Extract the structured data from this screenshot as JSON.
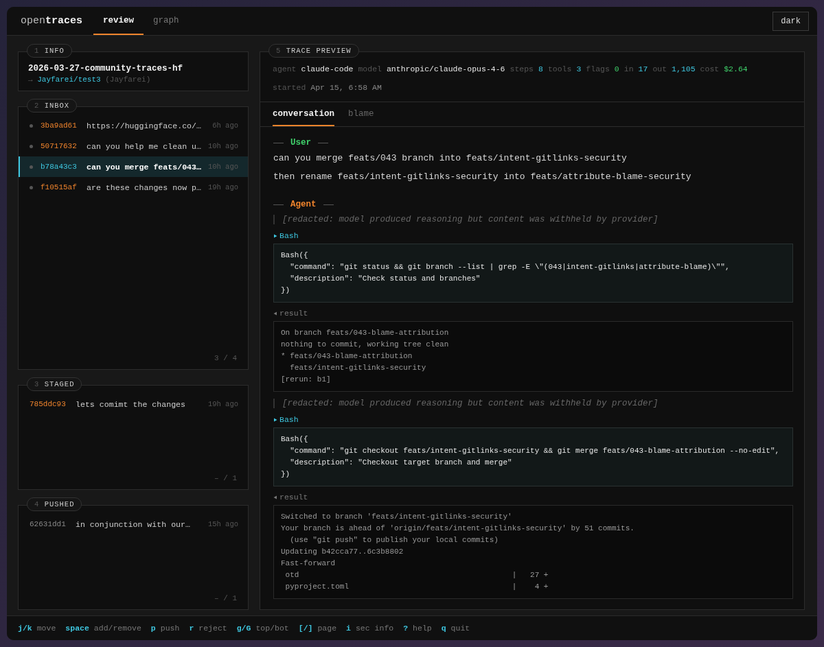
{
  "app": {
    "brand_light": "open",
    "brand_bold": "traces"
  },
  "tabs": [
    {
      "label": "review",
      "selected": true
    },
    {
      "label": "graph",
      "selected": false
    }
  ],
  "theme_button": "dark",
  "info": {
    "number": "1",
    "title": "INFO",
    "name": "2026-03-27-community-traces-hf",
    "arrow": "→",
    "repo": "Jayfarei/test3",
    "owner": "(Jayfarei)"
  },
  "sections": [
    {
      "kind": "inbox",
      "number": "2",
      "title": "INBOX",
      "counter": "3 / 4",
      "items": [
        {
          "hash": "3ba9ad61",
          "text": "https://huggingface.co/…",
          "time": "6h ago",
          "selected": false
        },
        {
          "hash": "50717632",
          "text": "can you help me clean u…",
          "time": "10h ago",
          "selected": false
        },
        {
          "hash": "b78a43c3",
          "text": "can you merge feats/043…",
          "time": "10h ago",
          "selected": true
        },
        {
          "hash": "f10515af",
          "text": "are these changes now p…",
          "time": "19h ago",
          "selected": false
        }
      ]
    },
    {
      "kind": "staged",
      "number": "3",
      "title": "STAGED",
      "counter": "– / 1",
      "items": [
        {
          "hash": "785ddc93",
          "text": "lets comimt the changes",
          "time": "19h ago",
          "selected": false
        }
      ]
    },
    {
      "kind": "pushed",
      "number": "4",
      "title": "PUSHED",
      "counter": "– / 1",
      "items": [
        {
          "hash": "62631dd1",
          "text": "in conjunction with our…",
          "time": "15h ago",
          "selected": false
        }
      ]
    }
  ],
  "preview": {
    "number": "5",
    "title": "TRACE PREVIEW",
    "stats": [
      {
        "label": "agent",
        "value": "claude-code",
        "kind": "plain"
      },
      {
        "label": "model",
        "value": "anthropic/claude-opus-4-6",
        "kind": "plain"
      },
      {
        "label": "steps",
        "value": "8",
        "kind": "count"
      },
      {
        "label": "tools",
        "value": "3",
        "kind": "count"
      },
      {
        "label": "flags",
        "value": "0",
        "kind": "good"
      },
      {
        "label": "in",
        "value": "17",
        "kind": "count"
      },
      {
        "label": "out",
        "value": "1,105",
        "kind": "count"
      },
      {
        "label": "cost",
        "value": "$2.64",
        "kind": "good"
      }
    ],
    "started_label": "started",
    "started": "Apr 15, 6:58 AM",
    "tabs": [
      {
        "label": "conversation",
        "selected": true
      },
      {
        "label": "blame",
        "selected": false
      }
    ],
    "blocks": [
      {
        "kind": "speaker",
        "label": "User",
        "color": "#3fcf6a"
      },
      {
        "kind": "message",
        "text": "can you merge feats/043 branch into feats/intent-gitlinks-security"
      },
      {
        "kind": "message",
        "text": "then rename feats/intent-gitlinks-security into feats/attribute-blame-security"
      },
      {
        "kind": "speaker",
        "label": "Agent",
        "color": "#f0842c"
      },
      {
        "kind": "redacted",
        "text": "[redacted: model produced reasoning but content was withheld by provider]"
      },
      {
        "kind": "tool",
        "label": "Bash",
        "lines": [
          "Bash({",
          "  \"command\": \"git status && git branch --list | grep -E \\\"(043|intent-gitlinks|attribute-blame)\\\"\",",
          "  \"description\": \"Check status and branches\"",
          "})"
        ]
      },
      {
        "kind": "result",
        "label": "result",
        "lines": [
          "On branch feats/043-blame-attribution",
          "nothing to commit, working tree clean",
          "* feats/043-blame-attribution",
          "  feats/intent-gitlinks-security",
          "[rerun: b1]"
        ]
      },
      {
        "kind": "redacted",
        "text": "[redacted: model produced reasoning but content was withheld by provider]"
      },
      {
        "kind": "tool",
        "label": "Bash",
        "lines": [
          "Bash({",
          "  \"command\": \"git checkout feats/intent-gitlinks-security && git merge feats/043-blame-attribution --no-edit\",",
          "  \"description\": \"Checkout target branch and merge\"",
          "})"
        ]
      },
      {
        "kind": "result",
        "label": "result",
        "lines": [
          "Switched to branch 'feats/intent-gitlinks-security'",
          "Your branch is ahead of 'origin/feats/intent-gitlinks-security' by 51 commits.",
          "  (use \"git push\" to publish your local commits)",
          "Updating b42cca77..6c3b8802",
          "Fast-forward",
          " otd                                               |   27 +",
          " pyproject.toml                                    |    4 +"
        ]
      }
    ]
  },
  "shortcuts": [
    {
      "key": "j/k",
      "label": "move"
    },
    {
      "key": "space",
      "label": "add/remove"
    },
    {
      "key": "p",
      "label": "push"
    },
    {
      "key": "r",
      "label": "reject"
    },
    {
      "key": "g/G",
      "label": "top/bot"
    },
    {
      "key": "[/]",
      "label": "page"
    },
    {
      "key": "i",
      "label": "sec info"
    },
    {
      "key": "?",
      "label": "help"
    },
    {
      "key": "q",
      "label": "quit"
    }
  ]
}
